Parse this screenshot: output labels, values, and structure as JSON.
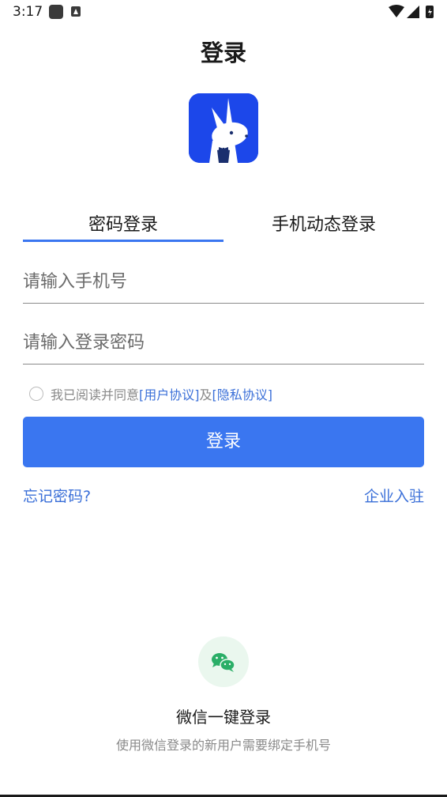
{
  "status_bar": {
    "time": "3:17"
  },
  "page": {
    "title": "登录"
  },
  "tabs": [
    {
      "label": "密码登录",
      "active": true
    },
    {
      "label": "手机动态登录",
      "active": false
    }
  ],
  "form": {
    "phone_placeholder": "请输入手机号",
    "phone_value": "",
    "password_placeholder": "请输入登录密码",
    "password_value": "",
    "agreement": {
      "checked": false,
      "prefix": "我已阅读并同意",
      "user_agreement": "[用户协议]",
      "conjunction": "及",
      "privacy_policy": "[隐私协议]"
    },
    "login_label": "登录"
  },
  "links": {
    "forgot_password": "忘记密码?",
    "enterprise": "企业入驻"
  },
  "wechat": {
    "icon": "wechat-icon",
    "title": "微信一键登录",
    "hint": "使用微信登录的新用户需要绑定手机号"
  },
  "colors": {
    "accent": "#3a76f0",
    "link": "#3a6fd8",
    "logo_bg": "#1c47ea",
    "wechat_green": "#2aae67"
  }
}
